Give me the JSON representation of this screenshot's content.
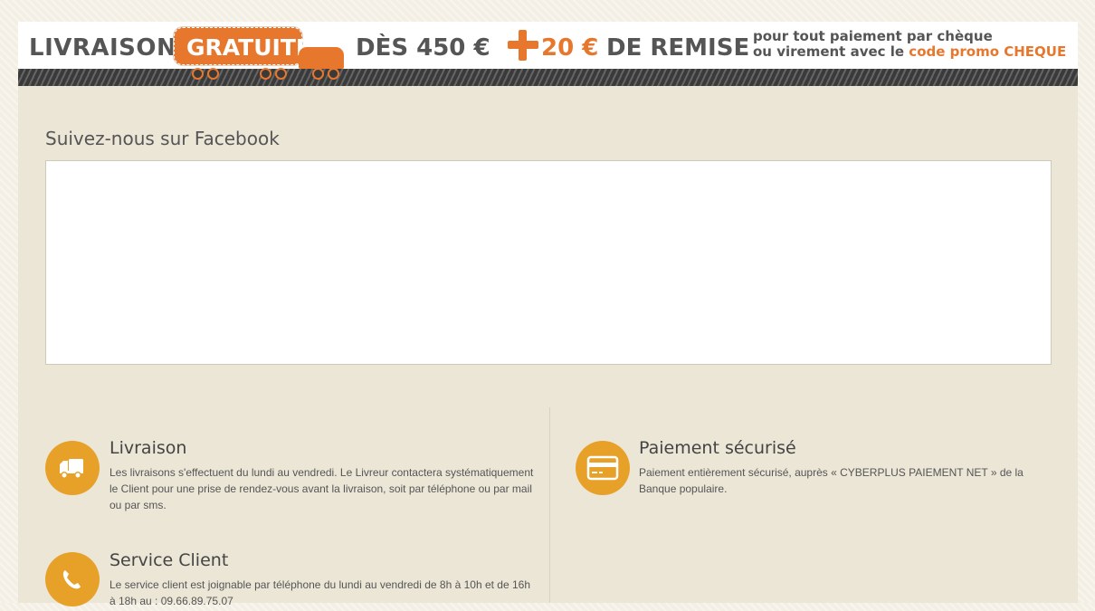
{
  "banner": {
    "livraison": "LIVRAISON",
    "gratuite": "GRATUITE",
    "des": "DÈS 450 €",
    "remise_amount": "20 €",
    "remise": "DE REMISE",
    "line1": "pour tout paiement par chèque",
    "line2_prefix": "ou virement avec le ",
    "line2_highlight": "code promo CHEQUE",
    "accent_color": "#e8772e"
  },
  "facebook": {
    "title": "Suivez-nous sur Facebook"
  },
  "features": [
    {
      "icon": "truck-icon",
      "title": "Livraison",
      "description": "Les livraisons s'effectuent du lundi au vendredi. Le Livreur contactera systématiquement le Client pour une prise de rendez-vous avant la livraison, soit par téléphone ou par mail ou par sms."
    },
    {
      "icon": "credit-card-icon",
      "title": "Paiement sécurisé",
      "description": "Paiement entièrement sécurisé, auprès « CYBERPLUS PAIEMENT NET » de la Banque populaire."
    },
    {
      "icon": "phone-icon",
      "title": "Service Client",
      "description": "Le service client est joignable par téléphone du lundi au vendredi de 8h à 10h et de 16h à 18h au : 09.66.89.75.07"
    }
  ],
  "colors": {
    "icon_bg": "#e8a128",
    "panel_bg": "#ebe6d6"
  }
}
